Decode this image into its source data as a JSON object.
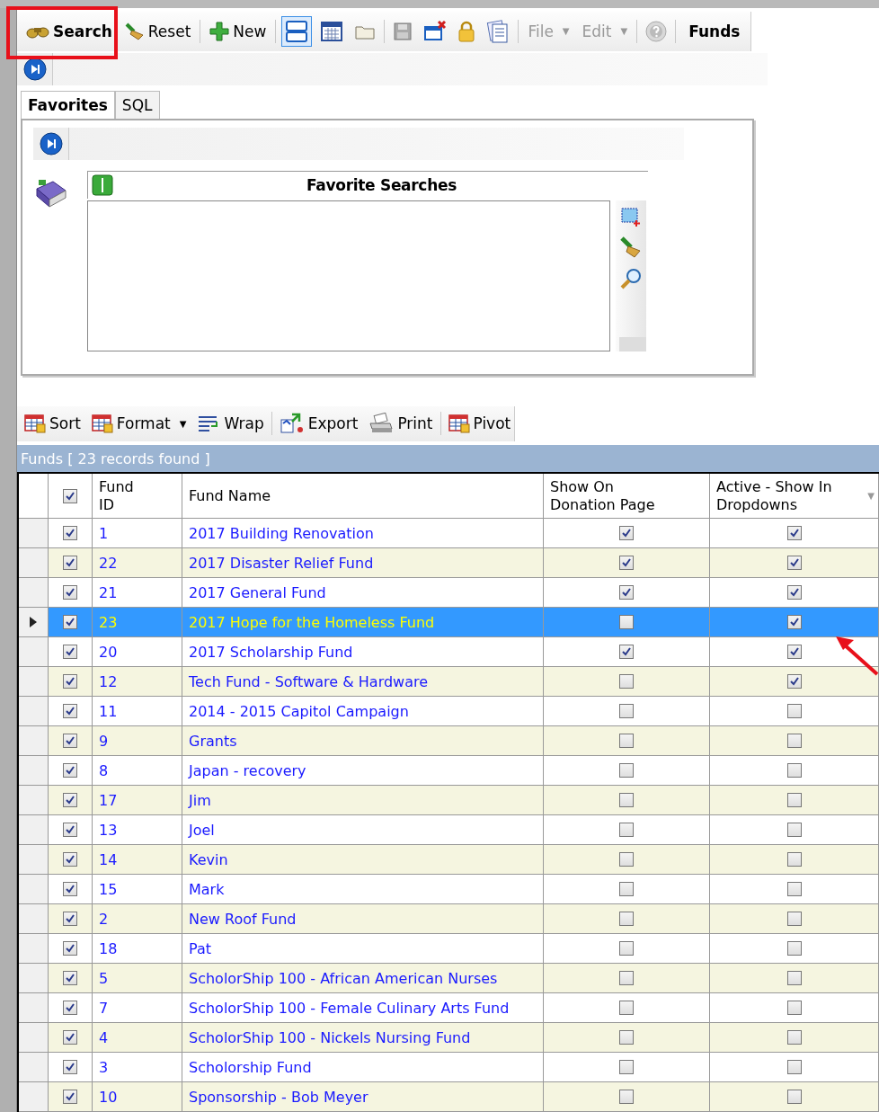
{
  "toolbar": {
    "items": [
      {
        "kind": "primary",
        "label": "Search"
      },
      {
        "kind": "button",
        "label": "Reset"
      },
      {
        "kind": "sep"
      },
      {
        "kind": "button",
        "label": "New"
      },
      {
        "kind": "sep"
      },
      {
        "kind": "icon",
        "selected": true
      },
      {
        "kind": "icon",
        "selected": false
      },
      {
        "kind": "icon",
        "selected": false
      },
      {
        "kind": "sep"
      },
      {
        "kind": "icon",
        "selected": false
      },
      {
        "kind": "icon",
        "selected": false
      },
      {
        "kind": "icon",
        "selected": false
      },
      {
        "kind": "icon",
        "selected": false
      },
      {
        "kind": "sep"
      },
      {
        "kind": "menu",
        "label": "File",
        "caret": "▼",
        "disabled": true
      },
      {
        "kind": "menu",
        "label": "Edit",
        "caret": "▼",
        "disabled": true
      },
      {
        "kind": "sep"
      },
      {
        "kind": "icon",
        "selected": false
      },
      {
        "kind": "sep"
      },
      {
        "kind": "title",
        "label": "Funds"
      }
    ]
  },
  "tabs": [
    {
      "label": "Favorites",
      "selected": true
    },
    {
      "label": "SQL",
      "selected": false
    }
  ],
  "favorites": {
    "title": "Favorite Searches"
  },
  "grid_toolbar": [
    {
      "kind": "button",
      "label": "Sort"
    },
    {
      "kind": "dropdown",
      "label": "Format",
      "caret": "▼"
    },
    {
      "kind": "button",
      "label": "Wrap"
    },
    {
      "kind": "sep"
    },
    {
      "kind": "button",
      "label": "Export"
    },
    {
      "kind": "button",
      "label": "Print"
    },
    {
      "kind": "sep"
    },
    {
      "kind": "button",
      "label": "Pivot"
    }
  ],
  "table": {
    "caption": "Funds [ 23 records found ]",
    "header_checked": true,
    "columns": [
      {
        "label": "Fund\nID"
      },
      {
        "label": "Fund Name"
      },
      {
        "label": "Show On\nDonation Page"
      },
      {
        "label": "Active - Show In\nDropdowns",
        "sort_glyph": "▼"
      }
    ],
    "rows": [
      {
        "checked": true,
        "id": "1",
        "name": "2017 Building Renovation",
        "show_on_donation_page": true,
        "active": true,
        "selected": false
      },
      {
        "checked": true,
        "id": "22",
        "name": "2017 Disaster Relief Fund",
        "show_on_donation_page": true,
        "active": true,
        "selected": false
      },
      {
        "checked": true,
        "id": "21",
        "name": "2017 General Fund",
        "show_on_donation_page": true,
        "active": true,
        "selected": false
      },
      {
        "checked": true,
        "id": "23",
        "name": "2017 Hope for the Homeless Fund",
        "show_on_donation_page": false,
        "active": true,
        "selected": true
      },
      {
        "checked": true,
        "id": "20",
        "name": "2017 Scholarship Fund",
        "show_on_donation_page": true,
        "active": true,
        "selected": false
      },
      {
        "checked": true,
        "id": "12",
        "name": "Tech Fund - Software & Hardware",
        "show_on_donation_page": false,
        "active": true,
        "selected": false
      },
      {
        "checked": true,
        "id": "11",
        "name": "2014 - 2015 Capitol Campaign",
        "show_on_donation_page": false,
        "active": false,
        "selected": false
      },
      {
        "checked": true,
        "id": "9",
        "name": "Grants",
        "show_on_donation_page": false,
        "active": false,
        "selected": false
      },
      {
        "checked": true,
        "id": "8",
        "name": "Japan - recovery",
        "show_on_donation_page": false,
        "active": false,
        "selected": false
      },
      {
        "checked": true,
        "id": "17",
        "name": "Jim",
        "show_on_donation_page": false,
        "active": false,
        "selected": false
      },
      {
        "checked": true,
        "id": "13",
        "name": "Joel",
        "show_on_donation_page": false,
        "active": false,
        "selected": false
      },
      {
        "checked": true,
        "id": "14",
        "name": "Kevin",
        "show_on_donation_page": false,
        "active": false,
        "selected": false
      },
      {
        "checked": true,
        "id": "15",
        "name": "Mark",
        "show_on_donation_page": false,
        "active": false,
        "selected": false
      },
      {
        "checked": true,
        "id": "2",
        "name": "New Roof Fund",
        "show_on_donation_page": false,
        "active": false,
        "selected": false
      },
      {
        "checked": true,
        "id": "18",
        "name": "Pat",
        "show_on_donation_page": false,
        "active": false,
        "selected": false
      },
      {
        "checked": true,
        "id": "5",
        "name": "ScholorShip 100 - African American Nurses",
        "show_on_donation_page": false,
        "active": false,
        "selected": false
      },
      {
        "checked": true,
        "id": "7",
        "name": "ScholorShip 100 - Female Culinary Arts Fund",
        "show_on_donation_page": false,
        "active": false,
        "selected": false
      },
      {
        "checked": true,
        "id": "4",
        "name": "ScholorShip 100 - Nickels Nursing Fund",
        "show_on_donation_page": false,
        "active": false,
        "selected": false
      },
      {
        "checked": true,
        "id": "3",
        "name": "Scholorship Fund",
        "show_on_donation_page": false,
        "active": false,
        "selected": false
      },
      {
        "checked": true,
        "id": "10",
        "name": "Sponsorship - Bob Meyer",
        "show_on_donation_page": false,
        "active": false,
        "selected": false
      }
    ]
  }
}
